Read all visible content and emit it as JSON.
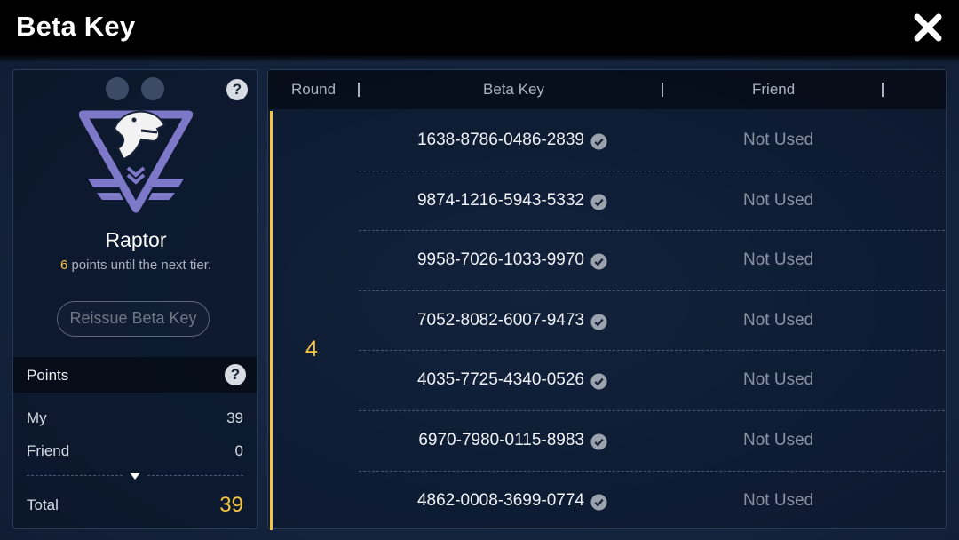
{
  "header": {
    "title": "Beta Key"
  },
  "tier": {
    "name": "Raptor",
    "points_needed": "6",
    "points_suffix": " points until the next tier.",
    "reissue_label": "Reissue Beta Key",
    "emblem_icon": "raptor-emblem-icon"
  },
  "points": {
    "title": "Points",
    "my_label": "My",
    "my_value": "39",
    "friend_label": "Friend",
    "friend_value": "0",
    "total_label": "Total",
    "total_value": "39"
  },
  "table": {
    "columns": [
      "Round",
      "Beta Key",
      "Friend"
    ],
    "round": "4",
    "rows": [
      {
        "key": "1638-8786-0486-2839",
        "status": "Not Used"
      },
      {
        "key": "9874-1216-5943-5332",
        "status": "Not Used"
      },
      {
        "key": "9958-7026-1033-9970",
        "status": "Not Used"
      },
      {
        "key": "7052-8082-6007-9473",
        "status": "Not Used"
      },
      {
        "key": "4035-7725-4340-0526",
        "status": "Not Used"
      },
      {
        "key": "6970-7980-0115-8983",
        "status": "Not Used"
      },
      {
        "key": "4862-0008-3699-0774",
        "status": "Not Used"
      }
    ]
  },
  "colors": {
    "accent": "#f5c542",
    "emblem": "#7d78c8",
    "background": "#162540"
  }
}
